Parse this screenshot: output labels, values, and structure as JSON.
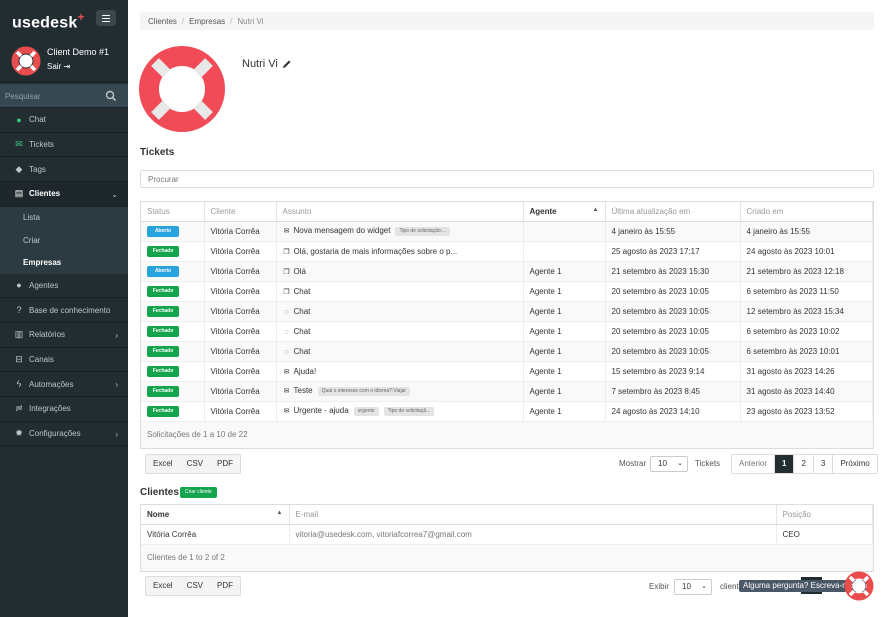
{
  "brand": {
    "name": "usedesk",
    "plus": "+"
  },
  "user": {
    "name": "Client Demo #1",
    "logout": "Sair"
  },
  "search": {
    "placeholder": "Pesquisar"
  },
  "nav": {
    "chat": "Chat",
    "tickets": "Tickets",
    "tags": "Tags",
    "clientes": "Clientes",
    "sub": {
      "lista": "Lista",
      "criar": "Criar",
      "empresas": "Empresas"
    },
    "agentes": "Agentes",
    "base": "Base de conhecimento",
    "relatorios": "Relatórios",
    "canais": "Canais",
    "automacoes": "Automações",
    "integracoes": "Integrações",
    "configuracoes": "Configurações"
  },
  "breadcrumb": {
    "a": "Clientes",
    "b": "Empresas",
    "c": "Nutri Vi"
  },
  "company": {
    "name": "Nutri Vi"
  },
  "tickets": {
    "title": "Tickets",
    "search_placeholder": "Procurar",
    "headers": {
      "status": "Status",
      "cliente": "Cliente",
      "assunto": "Assunto",
      "agente": "Agente",
      "atualizacao": "Última atualização em",
      "criado": "Criado em"
    },
    "rows": [
      {
        "status": "Aberto",
        "cliente": "Vitória Corrêa",
        "icon": "envelope-icon",
        "assunto": "Nova mensagem do widget",
        "tag": "Tipo de solicitação:...",
        "tag2": "",
        "agente": "",
        "atualizacao": "4 janeiro às 15:55",
        "criado": "4 janeiro às 15:55"
      },
      {
        "status": "Fechado",
        "cliente": "Vitória Corrêa",
        "icon": "chat-bubbles-icon",
        "assunto": "Olá, gostaria de mais informações sobre o p...",
        "tag": "",
        "tag2": "",
        "agente": "",
        "atualizacao": "25 agosto às 2023 17:17",
        "criado": "24 agosto às 2023 10:01"
      },
      {
        "status": "Aberto",
        "cliente": "Vitória Corrêa",
        "icon": "chat-bubbles-icon",
        "assunto": "Olá",
        "tag": "",
        "tag2": "",
        "agente": "Agente 1",
        "atualizacao": "21 setembro às 2023 15:30",
        "criado": "21 setembro às 2023 12:18"
      },
      {
        "status": "Fechado",
        "cliente": "Vitória Corrêa",
        "icon": "chat-bubbles-icon",
        "assunto": "Chat",
        "tag": "",
        "tag2": "",
        "agente": "Agente 1",
        "atualizacao": "20 setembro às 2023 10:05",
        "criado": "6 setembro às 2023 11:50"
      },
      {
        "status": "Fechado",
        "cliente": "Vitória Corrêa",
        "icon": "whatsapp-icon",
        "assunto": "Chat",
        "tag": "",
        "tag2": "",
        "agente": "Agente 1",
        "atualizacao": "20 setembro às 2023 10:05",
        "criado": "12 setembro às 2023 15:34"
      },
      {
        "status": "Fechado",
        "cliente": "Vitória Corrêa",
        "icon": "whatsapp-icon",
        "assunto": "Chat",
        "tag": "",
        "tag2": "",
        "agente": "Agente 1",
        "atualizacao": "20 setembro às 2023 10:05",
        "criado": "6 setembro às 2023 10:02"
      },
      {
        "status": "Fechado",
        "cliente": "Vitória Corrêa",
        "icon": "whatsapp-icon",
        "assunto": "Chat",
        "tag": "",
        "tag2": "",
        "agente": "Agente 1",
        "atualizacao": "20 setembro às 2023 10:05",
        "criado": "6 setembro às 2023 10:01"
      },
      {
        "status": "Fechado",
        "cliente": "Vitória Corrêa",
        "icon": "envelope-icon",
        "assunto": "Ajuda!",
        "tag": "",
        "tag2": "",
        "agente": "Agente 1",
        "atualizacao": "15 setembro às 2023 9:14",
        "criado": "31 agosto às 2023 14:26"
      },
      {
        "status": "Fechado",
        "cliente": "Vitória Corrêa",
        "icon": "envelope-icon",
        "assunto": "Teste",
        "tag": "Qual o interesse com o idioma?:Viajar",
        "tag2": "",
        "agente": "Agente 1",
        "atualizacao": "7 setembro às 2023 8:45",
        "criado": "31 agosto às 2023 14:40"
      },
      {
        "status": "Fechado",
        "cliente": "Vitória Corrêa",
        "icon": "envelope-icon",
        "assunto": "Urgente - ajuda",
        "tag": "urgente",
        "tag2": "Tipo de solicitaçã...",
        "agente": "Agente 1",
        "atualizacao": "24 agosto às 2023 14:10",
        "criado": "23 agosto às 2023 13:52"
      }
    ],
    "summary": "Solicitações de 1 a 10 de 22",
    "export": {
      "excel": "Excel",
      "csv": "CSV",
      "pdf": "PDF"
    },
    "show_label": "Mostrar",
    "page_size": "10",
    "after_label": "Tickets",
    "pager": {
      "prev": "Anterior",
      "p1": "1",
      "p2": "2",
      "p3": "3",
      "next": "Próximo"
    }
  },
  "clients": {
    "title": "Clientes",
    "create": "Criar cliente",
    "headers": {
      "nome": "Nome",
      "email": "E-mail",
      "posicao": "Posição"
    },
    "rows": [
      {
        "nome": "Vitória Corrêa",
        "email": "vitoria@usedesk.com, vitoriafcorrea7@gmail.com",
        "posicao": "CEO"
      }
    ],
    "summary": "Clientes de 1 to 2 of 2",
    "export": {
      "excel": "Excel",
      "csv": "CSV",
      "pdf": "PDF"
    },
    "show_label": "Exibir",
    "page_size": "10",
    "after_label": "client"
  },
  "chat_widget": {
    "text": "Alguma pergunta? Escreva-nos :)"
  },
  "colors": {
    "sidebar": "#222d32",
    "brand_red": "#e84c4c",
    "open_badge": "#29a3dd",
    "closed_badge": "#14a44d"
  }
}
